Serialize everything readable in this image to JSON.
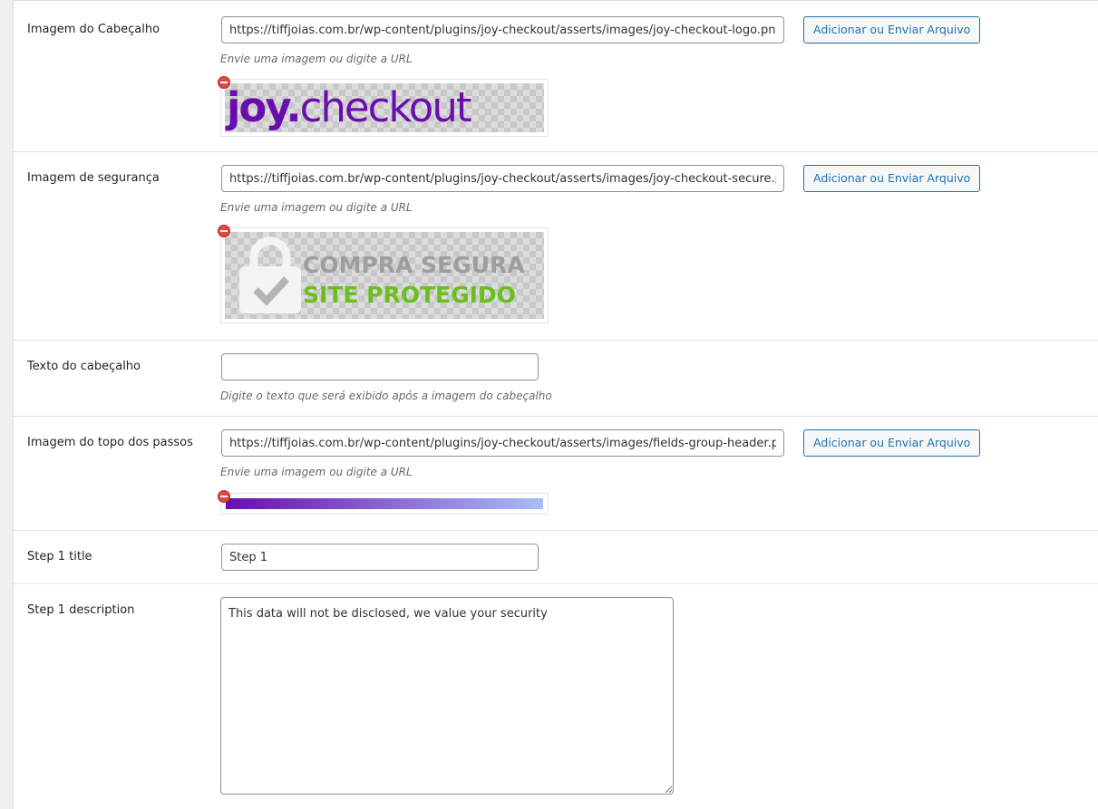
{
  "fields": {
    "header_image": {
      "label": "Imagem do Cabeçalho",
      "value": "https://tiffjoias.com.br/wp-content/plugins/joy-checkout/asserts/images/joy-checkout-logo.png",
      "button": "Adicionar ou Enviar Arquivo",
      "hint": "Envie uma imagem ou digite a URL",
      "preview": {
        "logo_part1": "joy",
        "logo_dot": ".",
        "logo_part2": "checkout",
        "color": "#6a0dad"
      }
    },
    "security_image": {
      "label": "Imagem de segurança",
      "value": "https://tiffjoias.com.br/wp-content/plugins/joy-checkout/asserts/images/joy-checkout-secure.png",
      "button": "Adicionar ou Enviar Arquivo",
      "hint": "Envie uma imagem ou digite a URL",
      "preview": {
        "line1": "COMPRA SEGURA",
        "line2": "SITE PROTEGIDO",
        "line1_color": "#9e9e9e",
        "line2_color": "#6abf1f"
      }
    },
    "header_text": {
      "label": "Texto do cabeçalho",
      "value": "",
      "hint": "Digite o texto que será exibido após a imagem do cabeçalho"
    },
    "steps_top_image": {
      "label": "Imagem do topo dos passos",
      "value": "https://tiffjoias.com.br/wp-content/plugins/joy-checkout/asserts/images/fields-group-header.png",
      "button": "Adicionar ou Enviar Arquivo",
      "hint": "Envie uma imagem ou digite a URL",
      "preview": {
        "gradient_start": "#6a0dad",
        "gradient_end": "#a9bdf5"
      }
    },
    "step1_title": {
      "label": "Step 1 title",
      "value": "Step 1"
    },
    "step1_description": {
      "label": "Step 1 description",
      "value": "This data will not be disclosed, we value your security"
    }
  },
  "colors": {
    "accent": "#2271b1",
    "remove": "#e04a3c"
  }
}
